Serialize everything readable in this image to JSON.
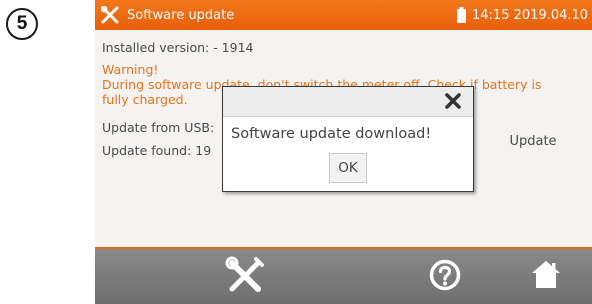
{
  "step": {
    "number": "5"
  },
  "titlebar": {
    "icon": "tools-icon",
    "title": "Software update",
    "battery_icon": "battery-icon",
    "clock": "14:15 2019.04.10"
  },
  "content": {
    "installed": "Installed version: - 1914",
    "warning_title": "Warning!",
    "warning_line1": "During software update, don't switch the meter off. Check if battery is",
    "warning_line2": "fully charged.",
    "usb_label": "Update from USB:",
    "found_label": "Update found: 19"
  },
  "update_button": {
    "label": "Update"
  },
  "dialog": {
    "close_icon": "close-icon",
    "message": "Software update download!",
    "ok_label": "OK"
  },
  "bottombar": {
    "tools_icon": "tools-icon",
    "help_icon": "help-icon",
    "home_icon": "home-icon"
  },
  "colors": {
    "accent": "#ea6a14",
    "warning_text": "#e8731b",
    "bottombar": "#7c7c7c"
  }
}
